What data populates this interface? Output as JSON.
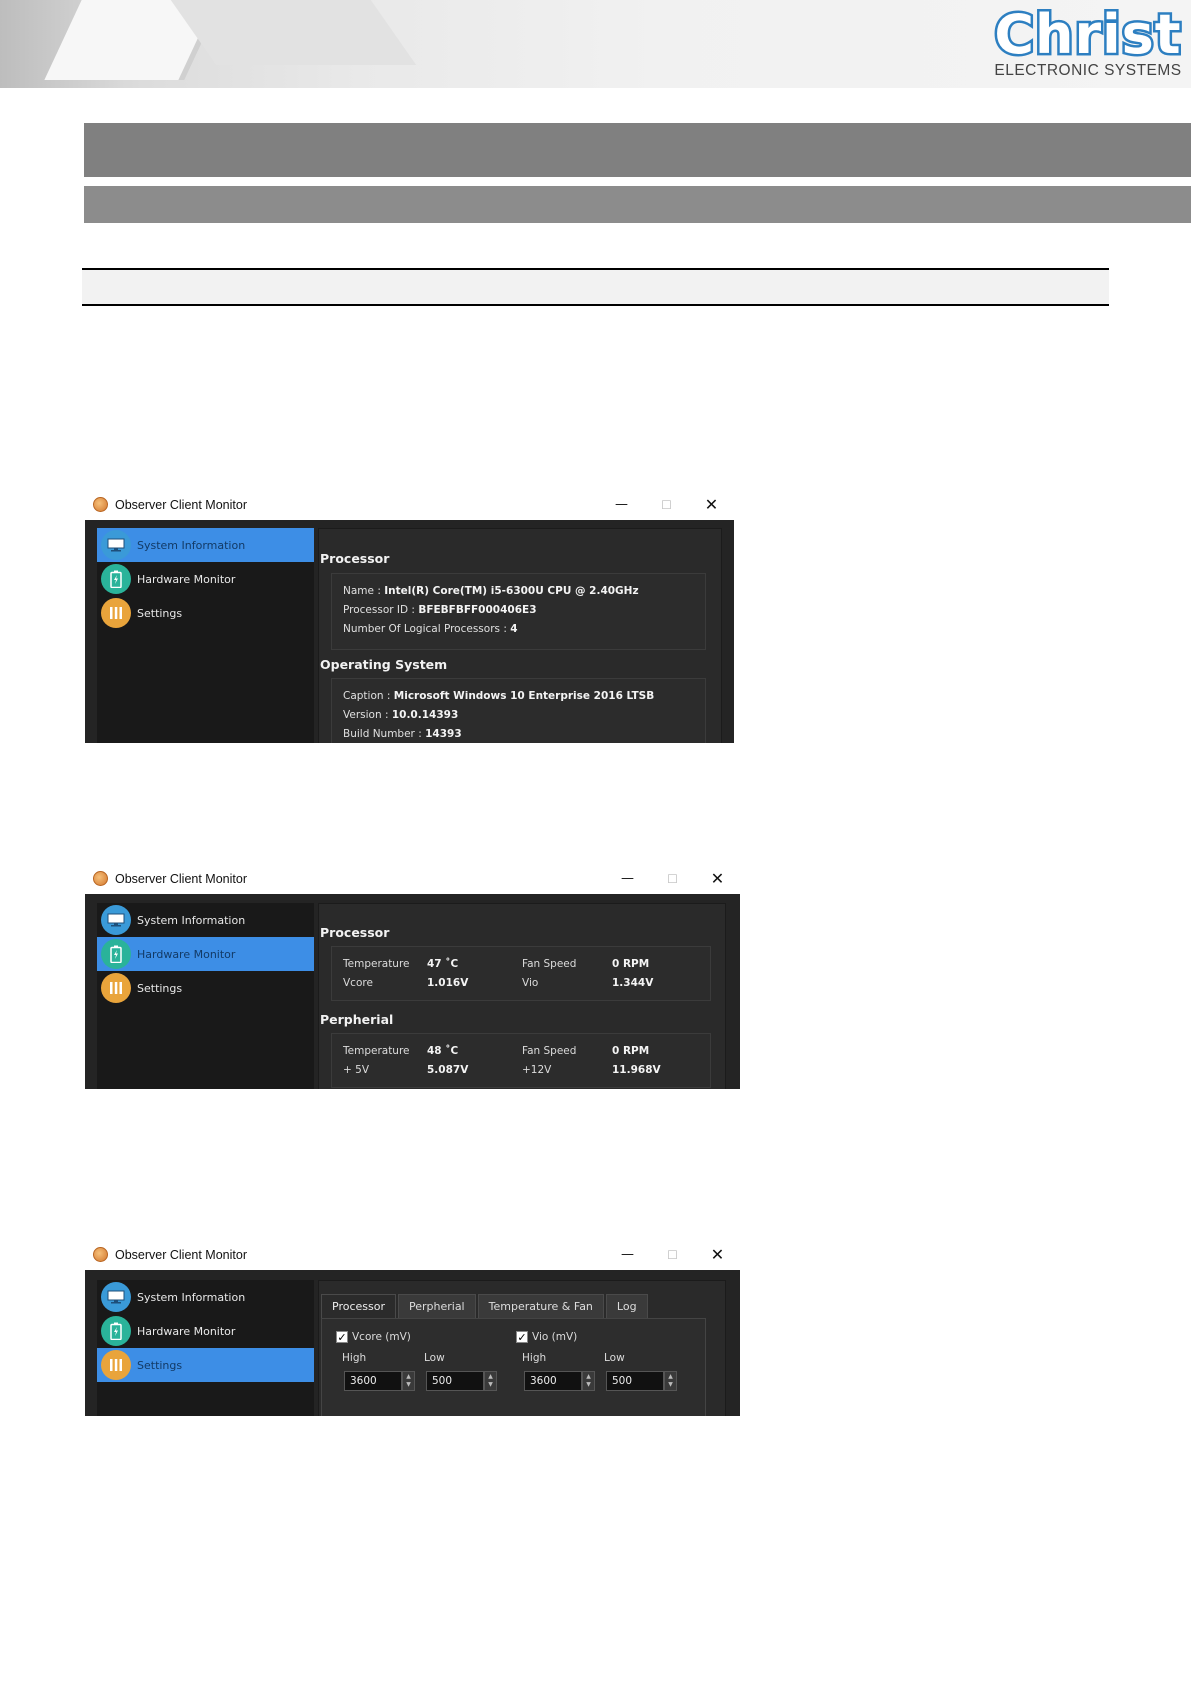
{
  "header": {
    "logo_text": "Christ",
    "logo_subtitle": "ELECTRONIC SYSTEMS"
  },
  "colors": {
    "gray_bar": "#808080",
    "brand_blue": "#2d7fc1",
    "active_nav": "#3d8ee6",
    "window_bg": "#242424"
  },
  "windows": [
    {
      "title": "Observer Client Monitor",
      "controls": {
        "minimize": "—",
        "maximize": "☐",
        "close": "✕"
      },
      "nav": [
        {
          "label": "System Information",
          "icon": "monitor-icon"
        },
        {
          "label": "Hardware Monitor",
          "icon": "battery-icon"
        },
        {
          "label": "Settings",
          "icon": "sliders-icon"
        }
      ],
      "active_nav": 0,
      "sections": {
        "processor": {
          "title": "Processor",
          "rows": [
            {
              "key": "Name : ",
              "value": "Intel(R) Core(TM) i5-6300U CPU @ 2.40GHz"
            },
            {
              "key": "Processor ID : ",
              "value": "BFEBFBFF000406E3"
            },
            {
              "key": "Number Of Logical Processors : ",
              "value": "4"
            }
          ]
        },
        "os": {
          "title": "Operating System",
          "rows": [
            {
              "key": "Caption : ",
              "value": "Microsoft Windows 10 Enterprise 2016 LTSB"
            },
            {
              "key": "Version : ",
              "value": "10.0.14393"
            },
            {
              "key": "Build Number : ",
              "value": "14393"
            }
          ]
        }
      }
    },
    {
      "title": "Observer Client Monitor",
      "controls": {
        "minimize": "—",
        "maximize": "☐",
        "close": "✕"
      },
      "nav": [
        {
          "label": "System Information",
          "icon": "monitor-icon"
        },
        {
          "label": "Hardware Monitor",
          "icon": "battery-icon"
        },
        {
          "label": "Settings",
          "icon": "sliders-icon"
        }
      ],
      "active_nav": 1,
      "sections": {
        "processor": {
          "title": "Processor",
          "cells": {
            "temp_label": "Temperature",
            "temp_value": "47 ˚C",
            "fan_label": "Fan Speed",
            "fan_value": "0 RPM",
            "vcore_label": "Vcore",
            "vcore_value": "1.016V",
            "vio_label": "Vio",
            "vio_value": "1.344V"
          }
        },
        "peripheral": {
          "title": "Perpherial",
          "cells": {
            "temp_label": "Temperature",
            "temp_value": "48 ˚C",
            "fan_label": "Fan Speed",
            "fan_value": "0 RPM",
            "v5_label": "+ 5V",
            "v5_value": "5.087V",
            "v12_label": "+12V",
            "v12_value": "11.968V"
          }
        }
      }
    },
    {
      "title": "Observer Client Monitor",
      "controls": {
        "minimize": "—",
        "maximize": "☐",
        "close": "✕"
      },
      "nav": [
        {
          "label": "System Information",
          "icon": "monitor-icon"
        },
        {
          "label": "Hardware Monitor",
          "icon": "battery-icon"
        },
        {
          "label": "Settings",
          "icon": "sliders-icon"
        }
      ],
      "active_nav": 2,
      "tabs": [
        "Processor",
        "Perpherial",
        "Temperature & Fan",
        "Log"
      ],
      "active_tab": 0,
      "vcore": {
        "label": "Vcore (mV)",
        "checked": true,
        "high_label": "High",
        "low_label": "Low",
        "high": "3600",
        "low": "500"
      },
      "vio": {
        "label": "Vio (mV)",
        "checked": true,
        "high_label": "High",
        "low_label": "Low",
        "high": "3600",
        "low": "500"
      }
    }
  ]
}
